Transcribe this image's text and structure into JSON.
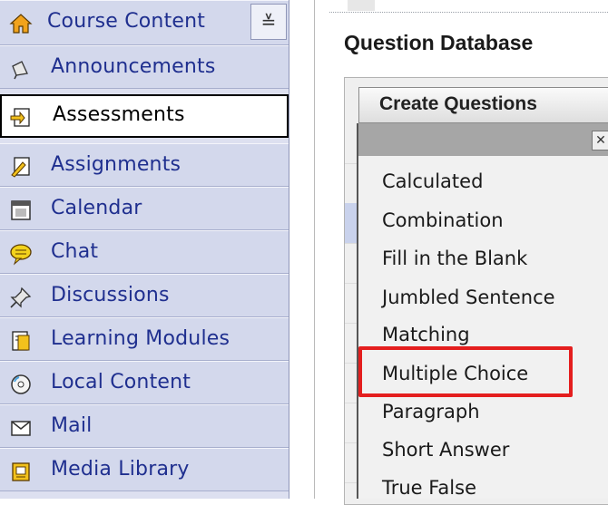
{
  "sidebar": {
    "header": {
      "label": "Course Content",
      "toggle": "≚"
    },
    "items": [
      {
        "label": "Announcements",
        "icon": "megaphone-icon"
      },
      {
        "label": "Assessments",
        "icon": "assessment-icon"
      },
      {
        "label": "Assignments",
        "icon": "assignment-icon"
      },
      {
        "label": "Calendar",
        "icon": "calendar-icon"
      },
      {
        "label": "Chat",
        "icon": "chat-icon"
      },
      {
        "label": "Discussions",
        "icon": "pushpin-icon"
      },
      {
        "label": "Learning Modules",
        "icon": "learning-module-icon"
      },
      {
        "label": "Local Content",
        "icon": "disc-icon"
      },
      {
        "label": "Mail",
        "icon": "mail-icon"
      },
      {
        "label": "Media Library",
        "icon": "media-library-icon"
      }
    ]
  },
  "main": {
    "title": "Question Database",
    "create_button": "Create Questions",
    "dropdown": {
      "close": "✕",
      "items": [
        "Calculated",
        "Combination",
        "Fill in the Blank",
        "Jumbled Sentence",
        "Matching",
        "Multiple Choice",
        "Paragraph",
        "Short Answer",
        "True False"
      ]
    }
  },
  "colors": {
    "sidebar_bg": "#d3d8ec",
    "link_text": "#1f2f8f",
    "highlight_box": "#e41e1e"
  }
}
